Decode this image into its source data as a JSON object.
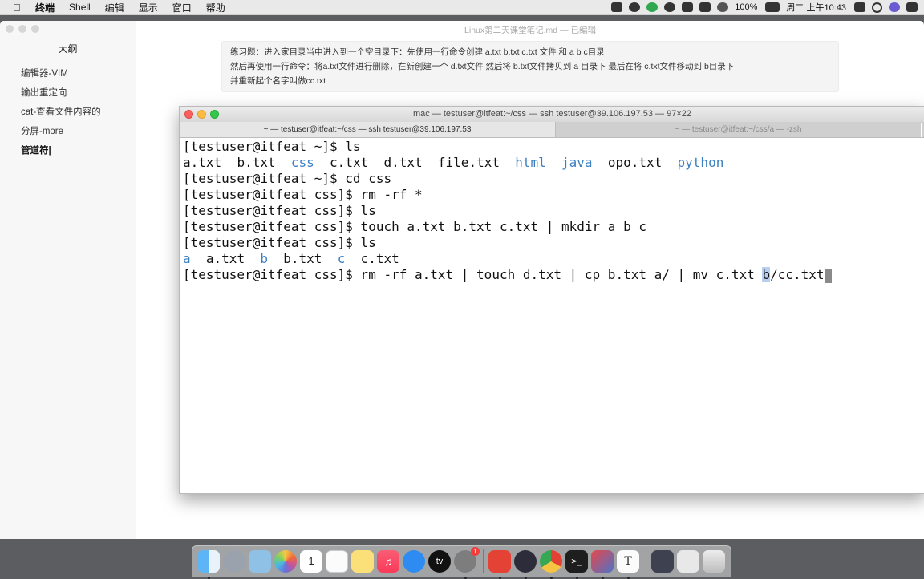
{
  "menubar": {
    "app": "终端",
    "items": [
      "Shell",
      "编辑",
      "显示",
      "窗口",
      "帮助"
    ],
    "battery": "100%",
    "clock": "周二 上午10:43"
  },
  "typora": {
    "title": "Linux第二天课堂笔记.md — 已编辑",
    "outline_heading": "大纲",
    "outline": [
      "编辑器-VIM",
      "输出重定向",
      "cat-查看文件内容的",
      "分屏-more",
      "管道符|"
    ],
    "note_lines": [
      "练习题：进入家目录当中进入到一个空目录下：先使用一行命令创建 a.txt b.txt c.txt 文件 和 a b c目录",
      "然后再使用一行命令：将a.txt文件进行删除，在新创建一个 d.txt文件 然后将 b.txt文件拷贝到 a 目录下 最后在将 c.txt文件移动到 b目录下",
      "并重新起个名字叫做cc.txt"
    ]
  },
  "terminal": {
    "title": "mac — testuser@itfeat:~/css — ssh testuser@39.106.197.53 — 97×22",
    "tabs": [
      "~ — testuser@itfeat:~/css — ssh testuser@39.106.197.53",
      "~ — testuser@itfeat:~/css/a — -zsh"
    ],
    "lines": {
      "l1": "[testuser@itfeat ~]$ ls",
      "l2": [
        {
          "t": "a.txt",
          "c": "plain"
        },
        {
          "t": "  b.txt  ",
          "c": "plain"
        },
        {
          "t": "css",
          "c": "dir"
        },
        {
          "t": "  c.txt  d.txt  file.txt  ",
          "c": "plain"
        },
        {
          "t": "html",
          "c": "dir"
        },
        {
          "t": "  ",
          "c": "plain"
        },
        {
          "t": "java",
          "c": "dir"
        },
        {
          "t": "  opo.txt  ",
          "c": "plain"
        },
        {
          "t": "python",
          "c": "dir"
        }
      ],
      "l3": "[testuser@itfeat ~]$ cd css",
      "l4": "[testuser@itfeat css]$ rm -rf *",
      "l5": "[testuser@itfeat css]$ ls",
      "l6": "[testuser@itfeat css]$ touch a.txt b.txt c.txt | mkdir a b c",
      "l7": "[testuser@itfeat css]$ ls",
      "l8": [
        {
          "t": "a",
          "c": "dir"
        },
        {
          "t": "  a.txt  ",
          "c": "plain"
        },
        {
          "t": "b",
          "c": "dir"
        },
        {
          "t": "  b.txt  ",
          "c": "plain"
        },
        {
          "t": "c",
          "c": "dir"
        },
        {
          "t": "  c.txt",
          "c": "plain"
        }
      ],
      "l9_pre": "[testuser@itfeat css]$ rm -rf a.txt | touch d.txt | cp b.txt a/ | mv c.txt ",
      "l9_sel": "b",
      "l9_post": "/cc.txt"
    }
  },
  "dock": {
    "apps": [
      "finder-icon",
      "launchpad-icon",
      "preview-icon",
      "photos-icon",
      "calendar-icon",
      "notes-icon",
      "stickies-icon",
      "music-icon",
      "safari-icon",
      "appletv-icon",
      "system-preferences-icon"
    ],
    "apps2": [
      "xmind-icon",
      "obs-icon",
      "chrome-icon",
      "terminal-icon",
      "parallels-icon",
      "typora-icon"
    ],
    "calendar_day": "1",
    "prefs_badge": "1"
  }
}
